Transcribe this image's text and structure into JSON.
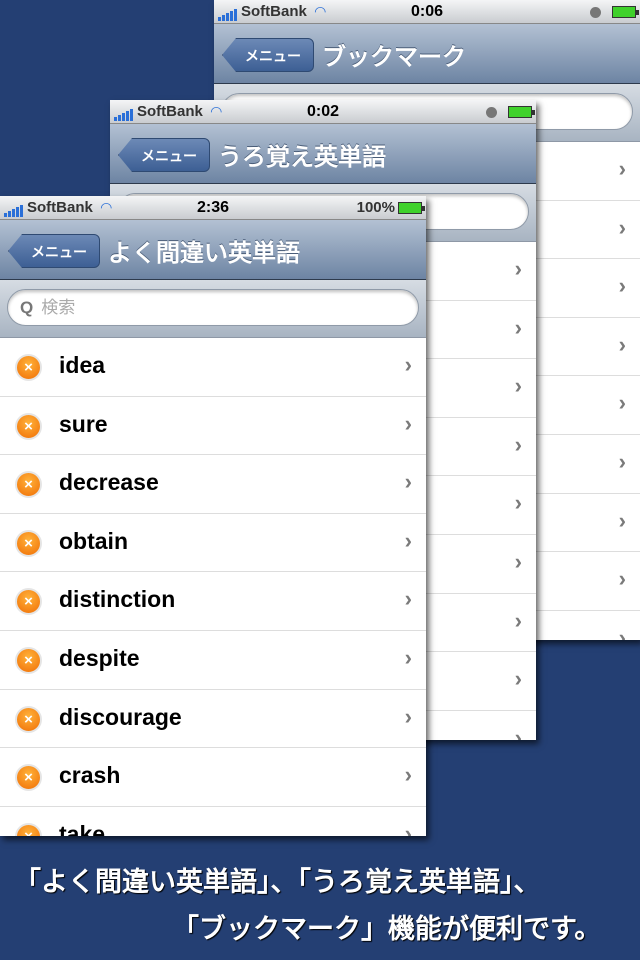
{
  "screens": [
    {
      "carrier": "SoftBank",
      "time": "0:06",
      "battery": "",
      "back": "メニュー",
      "title": "ブックマーク",
      "search_placeholder": "",
      "rows": [
        "",
        "",
        "",
        "",
        "",
        "",
        "",
        "",
        ""
      ]
    },
    {
      "carrier": "SoftBank",
      "time": "0:02",
      "battery": "",
      "back": "メニュー",
      "title": "うろ覚え英単語",
      "search_placeholder": "",
      "rows": [
        "",
        "",
        "",
        "",
        "",
        "",
        "",
        "",
        ""
      ]
    },
    {
      "carrier": "SoftBank",
      "time": "2:36",
      "battery": "100%",
      "back": "メニュー",
      "title": "よく間違い英単語",
      "search_placeholder": "検索",
      "rows": [
        "idea",
        "sure",
        "decrease",
        "obtain",
        "distinction",
        "despite",
        "discourage",
        "crash",
        "take"
      ]
    }
  ],
  "caption": {
    "line1": "「よく間違い英単語」、「うろ覚え英単語」、",
    "line2": "「ブックマーク」機能が便利です。"
  },
  "colors": {
    "background": "#243f73",
    "battery": "#3fd12b",
    "delete": "#f06e05"
  }
}
